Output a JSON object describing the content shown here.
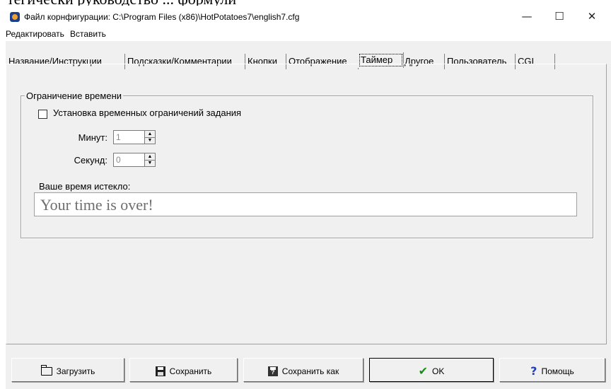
{
  "page_fragment": "тегически руководство ... формули",
  "window": {
    "title": "Файл корнфигурации: C:\\Program Files (x86)\\HotPotatoes7\\english7.cfg",
    "controls": {
      "minimize": "—",
      "maximize": "☐",
      "close": "✕"
    }
  },
  "menu": {
    "items": [
      "Редактировать",
      "Вставить"
    ]
  },
  "tabs": [
    {
      "label": "Название/Инструкции"
    },
    {
      "label": "Подсказки/Комментарии"
    },
    {
      "label": "Кнопки"
    },
    {
      "label": "Отображение"
    },
    {
      "label": "Таймер",
      "active": true
    },
    {
      "label": "Другое"
    },
    {
      "label": "Пользователь"
    },
    {
      "label": "CGI"
    }
  ],
  "time_limit": {
    "group_title": "Ограничение времени",
    "checkbox_label": "Установка временных ограничений задания",
    "checkbox_checked": false,
    "minutes_label": "Минут:",
    "minutes_value": "1",
    "seconds_label": "Секунд:",
    "seconds_value": "0",
    "message_label": "Ваше время истекло:",
    "message_value": "Your time is over!"
  },
  "buttons": {
    "load": "Загрузить",
    "save": "Сохранить",
    "save_as": "Сохранить как",
    "ok": "OK",
    "help": "Помощь"
  },
  "icons": {
    "load": "folder-open-icon",
    "save": "floppy-disk-icon",
    "save_as": "save-as-icon",
    "ok": "checkmark-icon",
    "help": "help-icon"
  }
}
